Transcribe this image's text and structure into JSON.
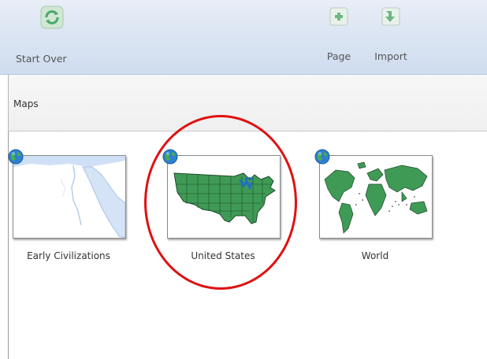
{
  "toolbar": {
    "start_over_label": "Start Over",
    "page_label": "Page",
    "import_label": "Import"
  },
  "section": {
    "title": "Maps"
  },
  "maps": [
    {
      "label": "Early Civilizations"
    },
    {
      "label": "United States"
    },
    {
      "label": "World"
    }
  ],
  "colors": {
    "map_green": "#3f9a55",
    "highlight_circle": "#e01010",
    "toolbar_bg": "#dde6f3"
  }
}
